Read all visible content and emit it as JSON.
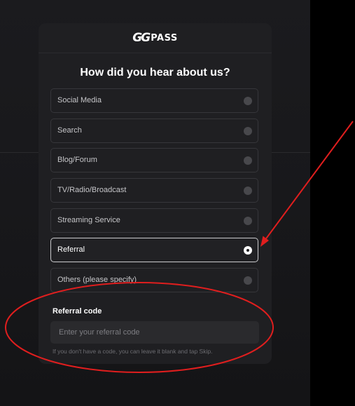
{
  "brand": {
    "mark": "GG",
    "name": "PASS"
  },
  "title": "How did you hear about us?",
  "options": [
    {
      "label": "Social Media",
      "selected": false
    },
    {
      "label": "Search",
      "selected": false
    },
    {
      "label": "Blog/Forum",
      "selected": false
    },
    {
      "label": "TV/Radio/Broadcast",
      "selected": false
    },
    {
      "label": "Streaming Service",
      "selected": false
    },
    {
      "label": "Referral",
      "selected": true
    },
    {
      "label": "Others (please specify)",
      "selected": false
    }
  ],
  "referral": {
    "label": "Referral code",
    "placeholder": "Enter your referral code",
    "value": "",
    "hint": "If you don't have a code, you can leave it blank and tap Skip."
  },
  "annotation_color": "#e01e1e"
}
